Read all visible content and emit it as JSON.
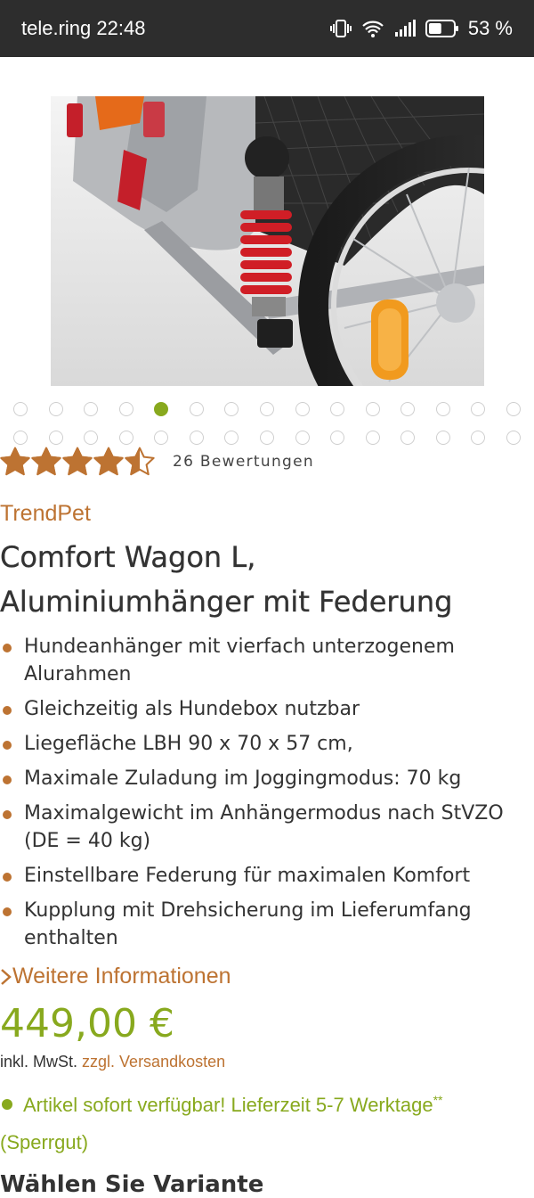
{
  "status_bar": {
    "carrier_time": "tele.ring 22:48",
    "battery": "53 %",
    "battery_level": 0.53
  },
  "gallery": {
    "image_alt": "Comfort Wagon L Federung",
    "total_images": 30,
    "active_index": 4
  },
  "rating": {
    "stars": 4.5,
    "max_stars": 5,
    "count_label": "26 Bewertungen",
    "star_color": "#bd7332"
  },
  "product": {
    "brand": "TrendPet",
    "title_line1": "Comfort Wagon L,",
    "title_line2": "Aluminiumhänger mit Federung",
    "features": [
      "Hundeanhänger mit vierfach unterzogenem Alurahmen",
      "Gleichzeitig als Hundebox nutzbar",
      "Liegefläche LBH 90 x 70 x 57 cm,",
      "Maximale Zuladung im Joggingmodus: 70 kg",
      "Maximalgewicht im Anhängermodus nach StVZO (DE = 40 kg)",
      "Einstellbare Federung für maximalen Komfort",
      "Kupplung mit Drehsicherung im Lieferumfang enthalten"
    ],
    "more_info_label": "Weitere Informationen",
    "price": "449,00 €",
    "tax_note": "inkl. MwSt.",
    "shipping_link": "zzgl. Versandkosten",
    "availability_text": "Artikel sofort verfügbar! Lieferzeit 5-7 Werktage",
    "availability_sup": "**",
    "availability_note": "(Sperrgut)",
    "variant_heading": "Wählen Sie Variante"
  },
  "colors": {
    "accent_orange": "#bd7332",
    "price_green": "#88a91e",
    "status_bar_bg": "#2d2d2d"
  }
}
